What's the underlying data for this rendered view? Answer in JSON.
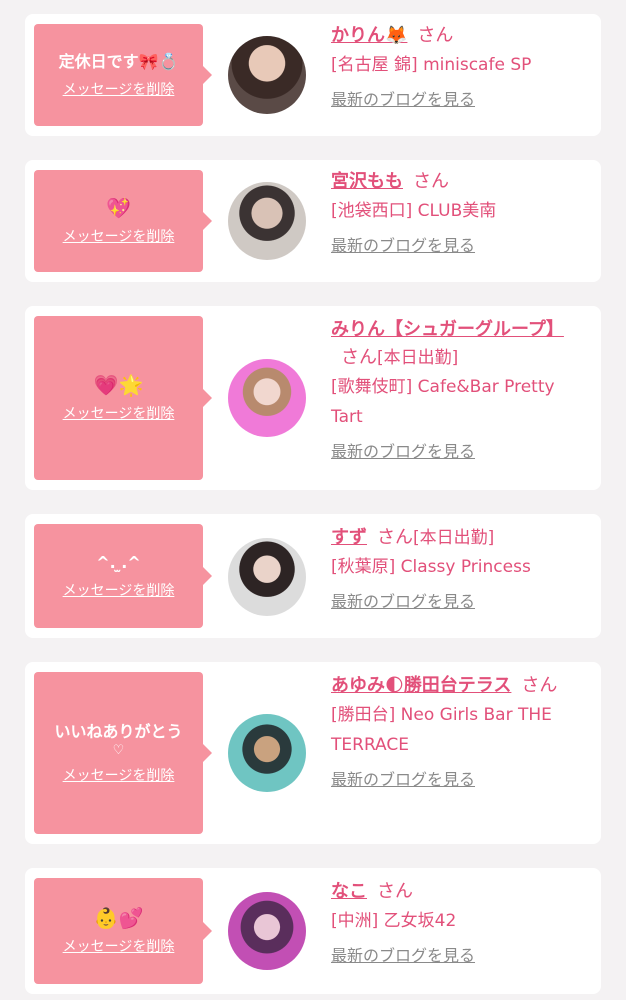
{
  "delete_label": "メッセージを削除",
  "blog_label": "最新のブログを見る",
  "san": "さん",
  "accent_color": "#e2507a",
  "bubble_color": "#f6939f",
  "items": [
    {
      "message": "定休日です🎀💍",
      "name": "かりん🦊",
      "status": "",
      "shop": "[名古屋 錦] miniscafe SP"
    },
    {
      "message": "💖",
      "name": "宮沢もも",
      "status": "",
      "shop": "[池袋西口] CLUB美南"
    },
    {
      "message": "💗🌟",
      "name": "みりん【シュガーグループ】",
      "status": "[本日出勤]",
      "shop": "[歌舞伎町] Cafe&Bar Pretty Tart"
    },
    {
      "message": "^. ̫.^",
      "name": "すず",
      "status": "[本日出勤]",
      "shop": "[秋葉原] Classy Princess"
    },
    {
      "message": "いいねありがとう",
      "message_sub": "♡",
      "name": "あゆみ🌓勝田台テラス",
      "status": "",
      "shop": "[勝田台] Neo Girls Bar THE TERRACE"
    },
    {
      "message": "👶💕",
      "name": "なこ",
      "status": "",
      "shop": "[中洲] 乙女坂42"
    }
  ]
}
